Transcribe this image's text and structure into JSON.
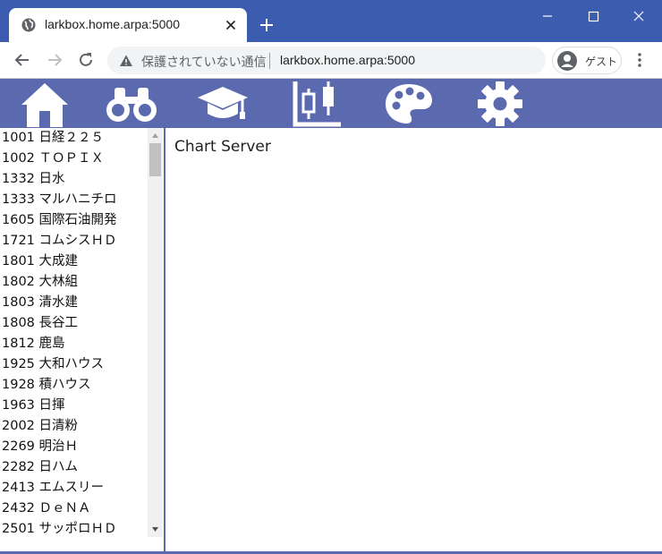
{
  "browser": {
    "tab_title": "larkbox.home.arpa:5000",
    "security_text": "保護されていない通信",
    "url": "larkbox.home.arpa:5000",
    "profile_label": "ゲスト",
    "accent_color": "#3c5cb0"
  },
  "nav": {
    "color": "#5b6aae",
    "items": [
      {
        "icon": "home-icon"
      },
      {
        "icon": "binoculars-icon"
      },
      {
        "icon": "graduation-cap-icon"
      },
      {
        "icon": "candlestick-chart-icon",
        "active": true
      },
      {
        "icon": "palette-icon"
      },
      {
        "icon": "gear-icon"
      }
    ]
  },
  "stocks": [
    "1001 日経２２５",
    "1002 ＴＯＰＩＸ",
    "1332 日水",
    "1333 マルハニチロ",
    "1605 国際石油開発",
    "1721 コムシスＨＤ",
    "1801 大成建",
    "1802 大林組",
    "1803 清水建",
    "1808 長谷工",
    "1812 鹿島",
    "1925 大和ハウス",
    "1928 積ハウス",
    "1963 日揮",
    "2002 日清粉",
    "2269 明治Ｈ",
    "2282 日ハム",
    "2413 エムスリー",
    "2432 ＤｅＮＡ",
    "2501 サッポロＨＤ"
  ],
  "main": {
    "title": "Chart Server"
  }
}
